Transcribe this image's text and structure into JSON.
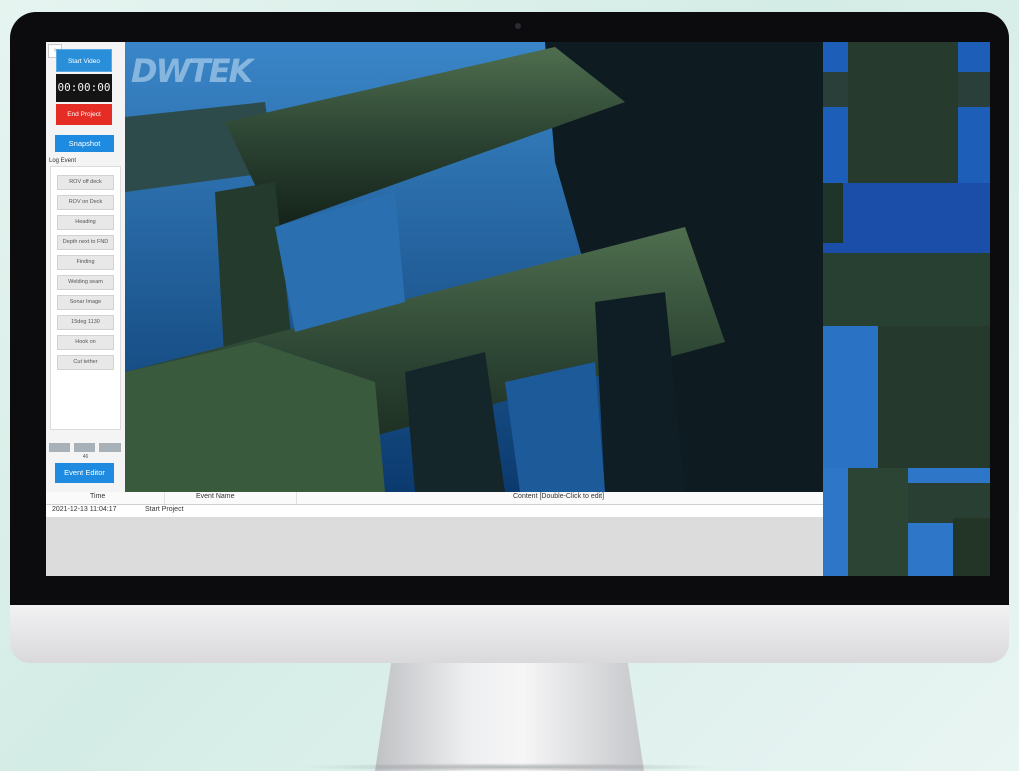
{
  "controls": {
    "start_video": "Start Video",
    "timer": "00:00:00",
    "end_project": "End Project",
    "snapshot": "Snapshot",
    "log_event_label": "Log Event",
    "event_editor": "Event Editor",
    "slider_value": "46"
  },
  "log_events": [
    "ROV off deck",
    "ROV on Deck",
    "Heading",
    "Depth next to FND",
    "Finding",
    "Welding seam",
    "Sonar Image",
    "15deg 1130",
    "Hook on",
    "Cut tether"
  ],
  "video": {
    "watermark": "DWTEK"
  },
  "event_table": {
    "columns": [
      "Time",
      "Event Name",
      "Content [Double-Click to edit]"
    ],
    "rows": [
      {
        "time": "2021-12-13 11:04:17",
        "event": "Start Project",
        "content": ""
      }
    ]
  },
  "colors": {
    "accent_blue": "#1f8be0",
    "end_red": "#e52d25",
    "timer_bg": "#141414",
    "water_blue": "#1b5fa0"
  }
}
